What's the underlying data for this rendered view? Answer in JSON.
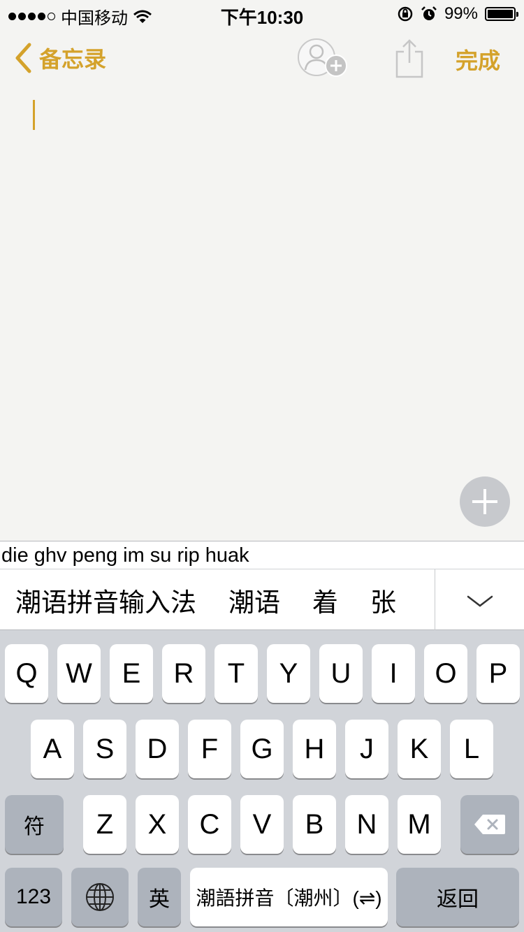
{
  "status_bar": {
    "carrier": "中国移动",
    "time": "下午10:30",
    "battery": "99%",
    "battery_level": 0.99,
    "signal_dots_filled": 4,
    "signal_dots_total": 5
  },
  "nav": {
    "back_label": "备忘录",
    "done_label": "完成"
  },
  "editor": {
    "text": ""
  },
  "ime": {
    "composition": "die ghv peng im su rip huak",
    "candidates": [
      "潮语拼音输入法",
      "潮语",
      "着",
      "张"
    ]
  },
  "keyboard": {
    "row1": [
      "Q",
      "W",
      "E",
      "R",
      "T",
      "Y",
      "U",
      "I",
      "O",
      "P"
    ],
    "row2": [
      "A",
      "S",
      "D",
      "F",
      "G",
      "H",
      "J",
      "K",
      "L"
    ],
    "row3": [
      "Z",
      "X",
      "C",
      "V",
      "B",
      "N",
      "M"
    ],
    "symbol_key": "符",
    "numbers_key": "123",
    "english_key": "英",
    "space_label": "潮語拼音〔潮州〕(⇌)",
    "return_key": "返回"
  },
  "colors": {
    "accent": "#d4a22b",
    "keyboard_bg": "#d1d4d9",
    "gray_key": "#adb3bc"
  }
}
